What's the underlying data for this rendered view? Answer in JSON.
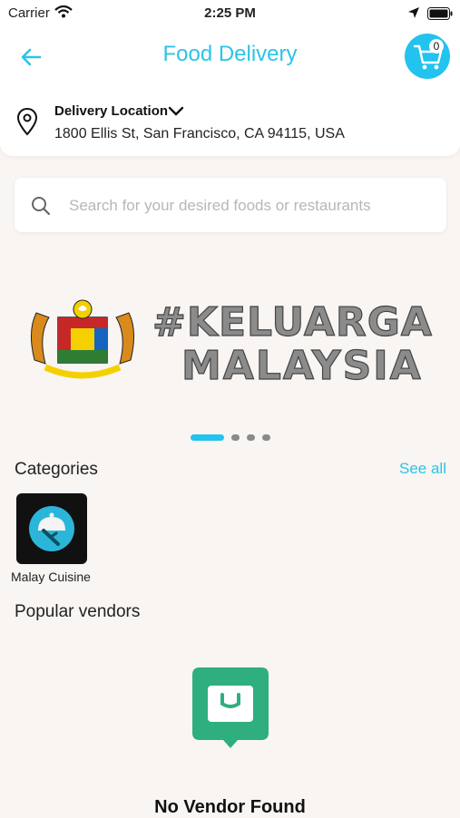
{
  "status_bar": {
    "carrier": "Carrier",
    "time": "2:25 PM"
  },
  "header": {
    "title": "Food Delivery",
    "cart_count": "0"
  },
  "location": {
    "label": "Delivery Location",
    "address": "1800 Ellis St, San Francisco, CA 94115, USA"
  },
  "search": {
    "placeholder": "Search for your desired foods or restaurants"
  },
  "banner": {
    "hashtag_text": "#KELUARGA MALAYSIA",
    "slide_count": 4,
    "active_slide": 1
  },
  "categories": {
    "title": "Categories",
    "see_all": "See all",
    "items": [
      {
        "label": "Malay Cuisine"
      }
    ]
  },
  "vendors": {
    "title": "Popular vendors",
    "empty_text": "No Vendor Found"
  },
  "colors": {
    "accent": "#22c3ee",
    "vendor_icon": "#2fae7e"
  }
}
